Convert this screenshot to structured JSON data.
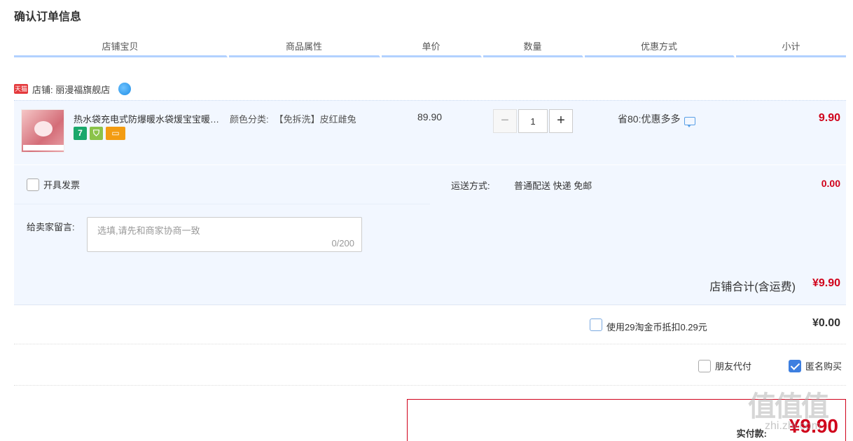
{
  "page": {
    "title": "确认订单信息"
  },
  "columns": [
    "店铺宝贝",
    "商品属性",
    "单价",
    "数量",
    "优惠方式",
    "小计"
  ],
  "shop": {
    "badge": "天猫",
    "name": "店铺: 丽漫福旗舰店",
    "ww_icon": "wangwang-icon"
  },
  "item": {
    "title": "热水袋充电式防爆暖水袋煖宝宝暖手宝",
    "sku_label": "颜色分类:",
    "sku_value": "【免拆洗】皮红雌兔",
    "price": "89.90",
    "qty_minus": "−",
    "quantity": "1",
    "qty_plus": "+",
    "promo": "省80:优惠多多",
    "subtotal": "9.90",
    "badges": [
      "7",
      "⛉",
      "▭"
    ]
  },
  "options": {
    "invoice_label": "开具发票",
    "message_label": "给卖家留言:",
    "message_placeholder": "选填,请先和商家协商一致",
    "message_count": "0/200",
    "shipping_label": "运送方式:",
    "shipping_value": "普通配送 快递 免邮",
    "shipping_fee": "0.00"
  },
  "shop_total": {
    "label": "店铺合计(含运费)",
    "amount": "¥9.90"
  },
  "coins": {
    "label": "使用29淘金币抵扣0.29元",
    "amount": "¥0.00"
  },
  "extras": {
    "friend_pay": "朋友代付",
    "anonymous": "匿名购买"
  },
  "pay": {
    "label": "实付款:",
    "amount": "¥9.90"
  },
  "watermark": {
    "text": "值值值",
    "url": "zhi.zhi.com"
  },
  "colors": {
    "accent": "#d0021b",
    "header_line": "#b2d1ff",
    "row_bg": "#f2f7ff",
    "check_blue": "#3d7fe0"
  }
}
